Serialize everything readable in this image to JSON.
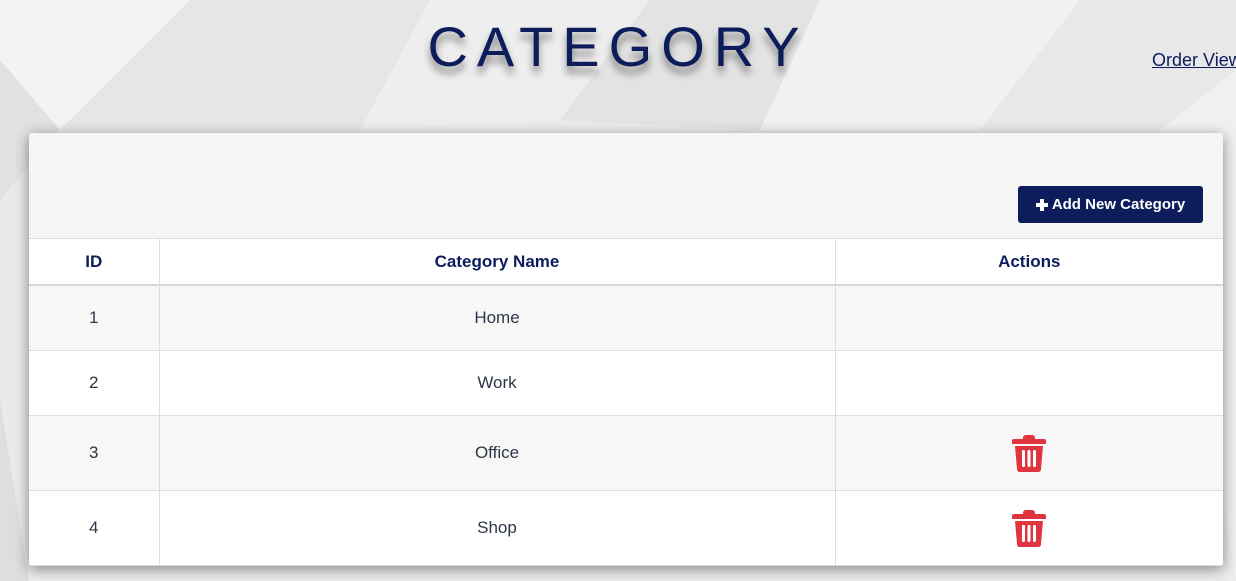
{
  "header": {
    "title": "CATEGORY",
    "order_link": "Order View"
  },
  "toolbar": {
    "add_label": "Add New Category",
    "add_icon": "plus-icon"
  },
  "table": {
    "columns": [
      "ID",
      "Category Name",
      "Actions"
    ],
    "rows": [
      {
        "id": "1",
        "name": "Home",
        "deletable": false
      },
      {
        "id": "2",
        "name": "Work",
        "deletable": false
      },
      {
        "id": "3",
        "name": "Office",
        "deletable": true
      },
      {
        "id": "4",
        "name": "Shop",
        "deletable": true
      }
    ],
    "delete_icon": "trash-icon"
  },
  "colors": {
    "brand": "#0d1d5c",
    "danger": "#e0353f",
    "background": "#ededed"
  }
}
